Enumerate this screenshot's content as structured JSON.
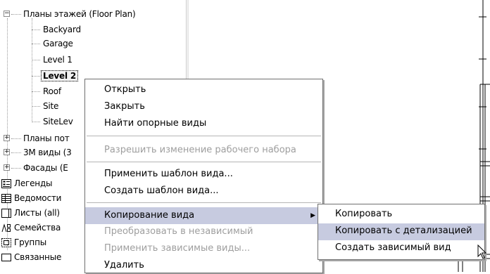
{
  "tree": {
    "floor_plans": {
      "label": "Планы этажей (Floor Plan)",
      "children": [
        "Backyard",
        "Garage",
        "Level 1",
        "Level 2",
        "Roof",
        "Site",
        "SiteLev"
      ]
    },
    "collapsed_groups": [
      "Планы пот",
      "3М виды (3",
      "Фасады (Е"
    ],
    "items": [
      {
        "label": "Легенды",
        "icon": "legends-icon"
      },
      {
        "label": "Ведомости",
        "icon": "schedules-icon"
      },
      {
        "label": "Листы (all)",
        "icon": "sheets-icon"
      },
      {
        "label": "Семейства",
        "icon": "families-icon"
      },
      {
        "label": "Группы",
        "icon": "groups-icon"
      },
      {
        "label": "Связанные",
        "icon": "links-icon"
      }
    ]
  },
  "context_menu": {
    "open": "Открыть",
    "close": "Закрыть",
    "find_ref": "Найти опорные виды",
    "allow_workset": "Разрешить изменение рабочего набора",
    "apply_template": "Применить шаблон вида...",
    "create_template": "Создать шаблон вида...",
    "copy_view": "Копирование вида",
    "make_independent": "Преобразовать в независимый",
    "apply_dependent": "Применить зависимые виды...",
    "delete": "Удалить"
  },
  "submenu": {
    "copy": "Копировать",
    "copy_detailing": "Копировать с детализацией",
    "create_dependent": "Создать зависимый вид"
  },
  "colors": {
    "highlight": "#c7cbe0",
    "disabled_text": "#9e9e9e",
    "menu_border": "#6f6f6f"
  }
}
